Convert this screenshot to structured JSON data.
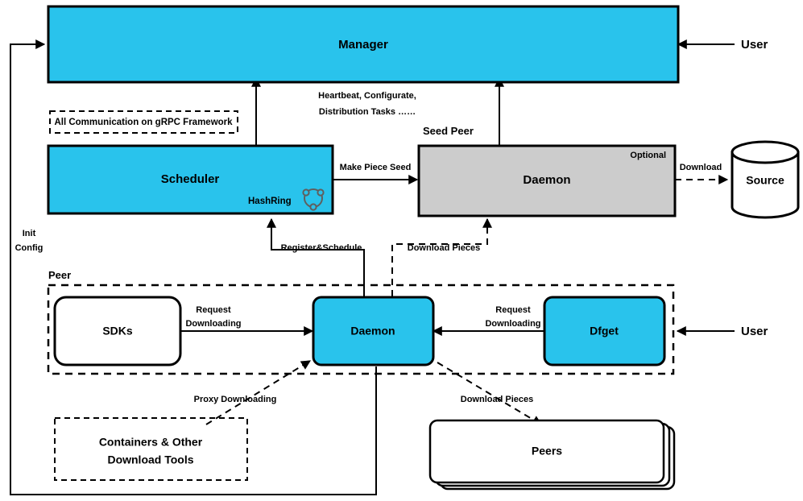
{
  "diagram": {
    "title": "Dragonfly Architecture",
    "colors": {
      "accent_cyan": "#29c3ec",
      "gray_fill": "#cccccc",
      "white_fill": "#ffffff",
      "stroke": "#000000",
      "hashring_stroke": "#5f5f5f"
    },
    "nodes": {
      "manager": {
        "label": "Manager",
        "fill": "#29c3ec",
        "shape": "rect"
      },
      "scheduler": {
        "label": "Scheduler",
        "fill": "#29c3ec",
        "shape": "rect",
        "badge": "HashRing",
        "badge_icon": "hashring-icon"
      },
      "seed_peer_daemon": {
        "label": "Daemon",
        "fill": "#cccccc",
        "shape": "rect",
        "corner_tag": "Optional"
      },
      "source": {
        "label": "Source",
        "fill": "#ffffff",
        "shape": "cylinder"
      },
      "sdks": {
        "label": "SDKs",
        "fill": "#ffffff",
        "shape": "rounded-rect"
      },
      "peer_daemon": {
        "label": "Daemon",
        "fill": "#29c3ec",
        "shape": "rounded-rect"
      },
      "dfget": {
        "label": "Dfget",
        "fill": "#29c3ec",
        "shape": "rounded-rect"
      },
      "containers": {
        "label_line1": "Containers & Other",
        "label_line2": "Download Tools",
        "fill": "#ffffff",
        "shape": "dashed-rect"
      },
      "peers": {
        "label": "Peers",
        "fill": "#ffffff",
        "shape": "stacked-rect"
      }
    },
    "groups": {
      "seed_peer": {
        "label": "Seed Peer"
      },
      "peer": {
        "label": "Peer"
      }
    },
    "notes": {
      "grpc": {
        "label": "All Communication on gRPC Framework"
      }
    },
    "actors": {
      "user_top": {
        "label": "User"
      },
      "user_bottom": {
        "label": "User"
      }
    },
    "edges": {
      "heartbeat": {
        "line1": "Heartbeat, Configurate,",
        "line2": "Distribution Tasks ……"
      },
      "make_piece_seed": {
        "label": "Make Piece Seed"
      },
      "download_source": {
        "label": "Download"
      },
      "init_config": {
        "line1": "Init",
        "line2": "Config"
      },
      "register_schedule": {
        "label": "Register&Schedule"
      },
      "download_pieces_seed": {
        "label": "Download Pieces"
      },
      "request_downloading_sdks": {
        "line1": "Request",
        "line2": "Downloading"
      },
      "request_downloading_dfget": {
        "line1": "Request",
        "line2": "Downloading"
      },
      "proxy_downloading": {
        "label": "Proxy Downloading"
      },
      "download_pieces_peers": {
        "label": "Download Pieces"
      }
    }
  }
}
